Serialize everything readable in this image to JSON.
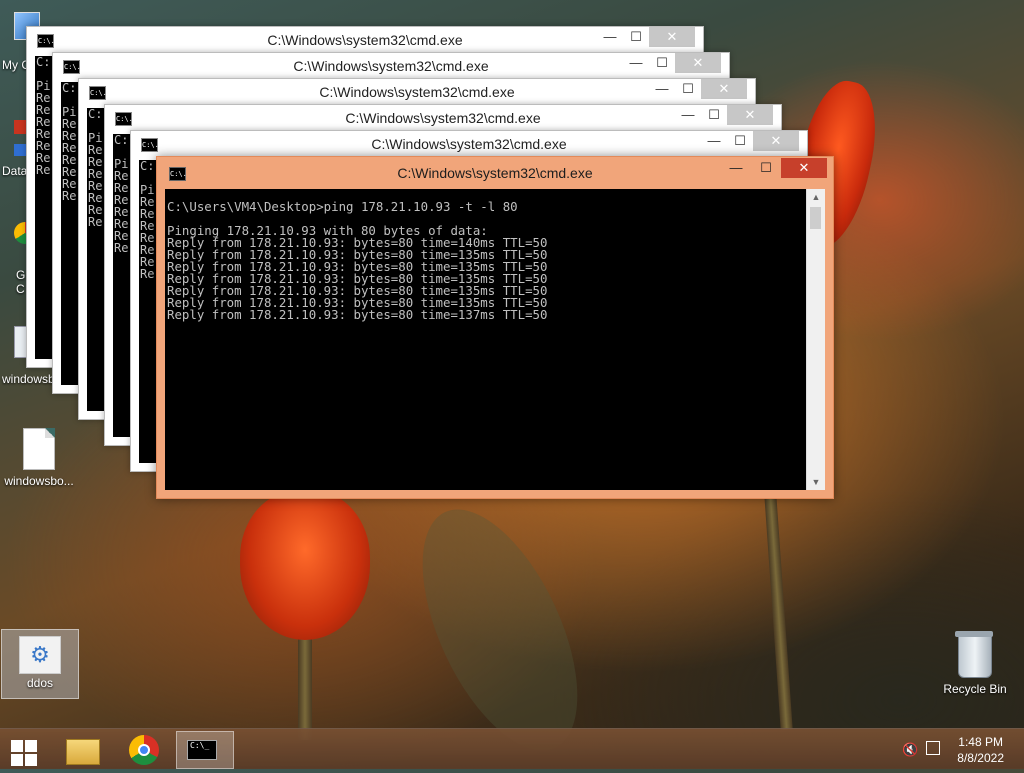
{
  "desktop": {
    "icons": [
      {
        "label": "My C",
        "type": "computer"
      },
      {
        "label": "Data",
        "type": "shortcut"
      },
      {
        "label": "G\nC",
        "type": "chrome"
      },
      {
        "label": "windowsb",
        "type": "image"
      },
      {
        "label": "windowsbo...",
        "type": "document"
      },
      {
        "label": "ddos",
        "type": "settings"
      },
      {
        "label": "Recycle Bin",
        "type": "recycle-bin"
      }
    ]
  },
  "windows": {
    "title": "C:\\Windows\\system32\\cmd.exe",
    "icon_text": "C:\\.",
    "background_cols": [
      "C:",
      "Pi",
      "Re"
    ],
    "minimize": "—",
    "maximize": "☐",
    "close": "✕"
  },
  "console": {
    "lines": [
      "C:\\Users\\VM4\\Desktop>ping 178.21.10.93 -t -l 80",
      "",
      "Pinging 178.21.10.93 with 80 bytes of data:",
      "Reply from 178.21.10.93: bytes=80 time=140ms TTL=50",
      "Reply from 178.21.10.93: bytes=80 time=135ms TTL=50",
      "Reply from 178.21.10.93: bytes=80 time=135ms TTL=50",
      "Reply from 178.21.10.93: bytes=80 time=135ms TTL=50",
      "Reply from 178.21.10.93: bytes=80 time=135ms TTL=50",
      "Reply from 178.21.10.93: bytes=80 time=135ms TTL=50",
      "Reply from 178.21.10.93: bytes=80 time=137ms TTL=50"
    ]
  },
  "taskbar": {
    "cmd_icon_text": "C:\\_",
    "time": "1:48 PM",
    "date": "8/8/2022"
  }
}
